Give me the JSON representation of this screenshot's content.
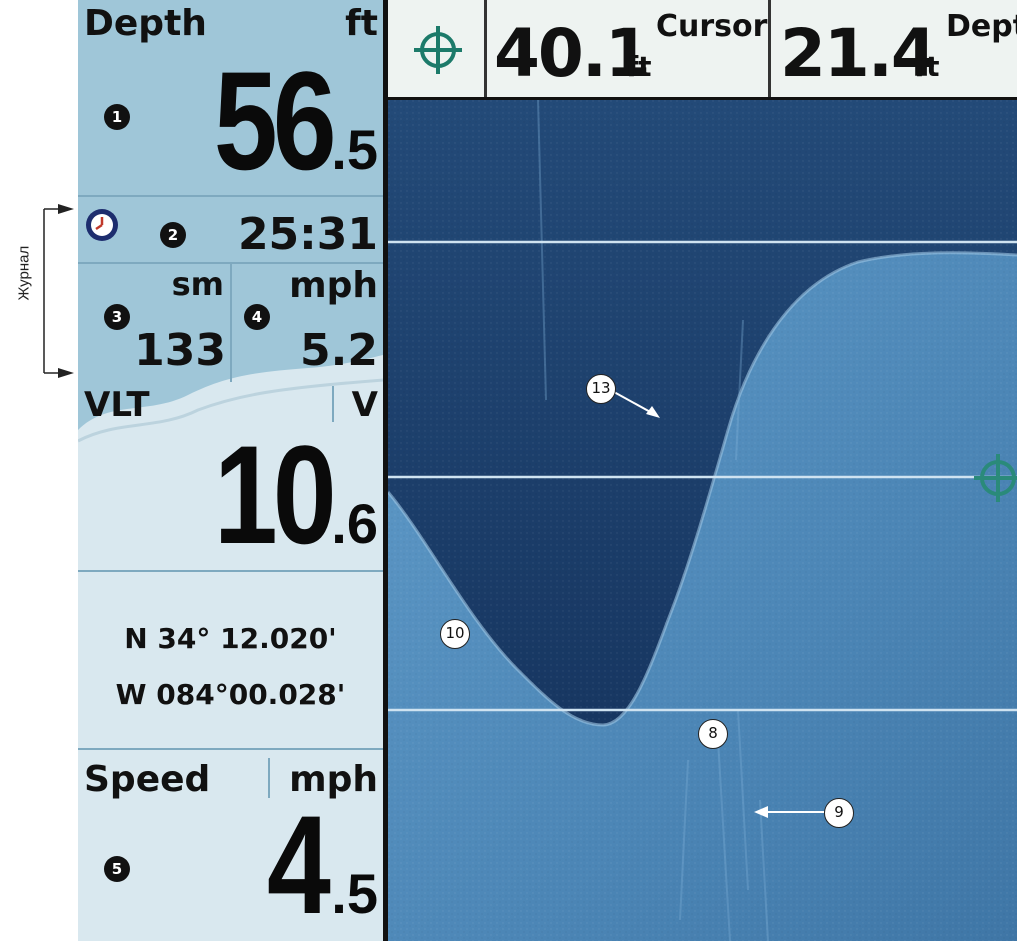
{
  "annotation": {
    "log_label": "Журнал"
  },
  "panel": {
    "depth": {
      "label": "Depth",
      "unit": "ft",
      "value_int": "56",
      "value_dec": ".5",
      "callout": "1"
    },
    "timer": {
      "value": "25:31",
      "callout": "2",
      "icon": "clock-icon"
    },
    "distance": {
      "unit": "sm",
      "value": "133",
      "callout": "3"
    },
    "speed_small": {
      "unit": "mph",
      "value": "5.2",
      "callout": "4"
    },
    "voltage": {
      "label": "VLT",
      "unit": "V",
      "value_int": "10",
      "value_dec": ".6"
    },
    "position": {
      "lat": "N 34° 12.020'",
      "lon": "W 084°00.028'"
    },
    "speed": {
      "label": "Speed",
      "unit": "mph",
      "value_int": "4",
      "value_dec": ".5",
      "callout": "5"
    }
  },
  "topbar": {
    "cursor_icon": "crosshair-icon",
    "cursor": {
      "value": "40.1",
      "unit": "ft",
      "label": "Cursor"
    },
    "depth": {
      "value": "21.4",
      "unit": "ft",
      "label": "Dept"
    }
  },
  "sonar": {
    "callouts": [
      {
        "id": "13",
        "label": "13"
      },
      {
        "id": "10",
        "label": "10"
      },
      {
        "id": "8",
        "label": "8"
      },
      {
        "id": "9",
        "label": "9"
      }
    ],
    "cursor_icon": "crosshair-icon"
  },
  "colors": {
    "panel_bg": "#9fc6d8",
    "sonar_water": "#1c3e66",
    "sonar_bottom": "#4f88b8",
    "topbar_bg": "#eef3f1",
    "crosshair": "#1c7a6a"
  }
}
